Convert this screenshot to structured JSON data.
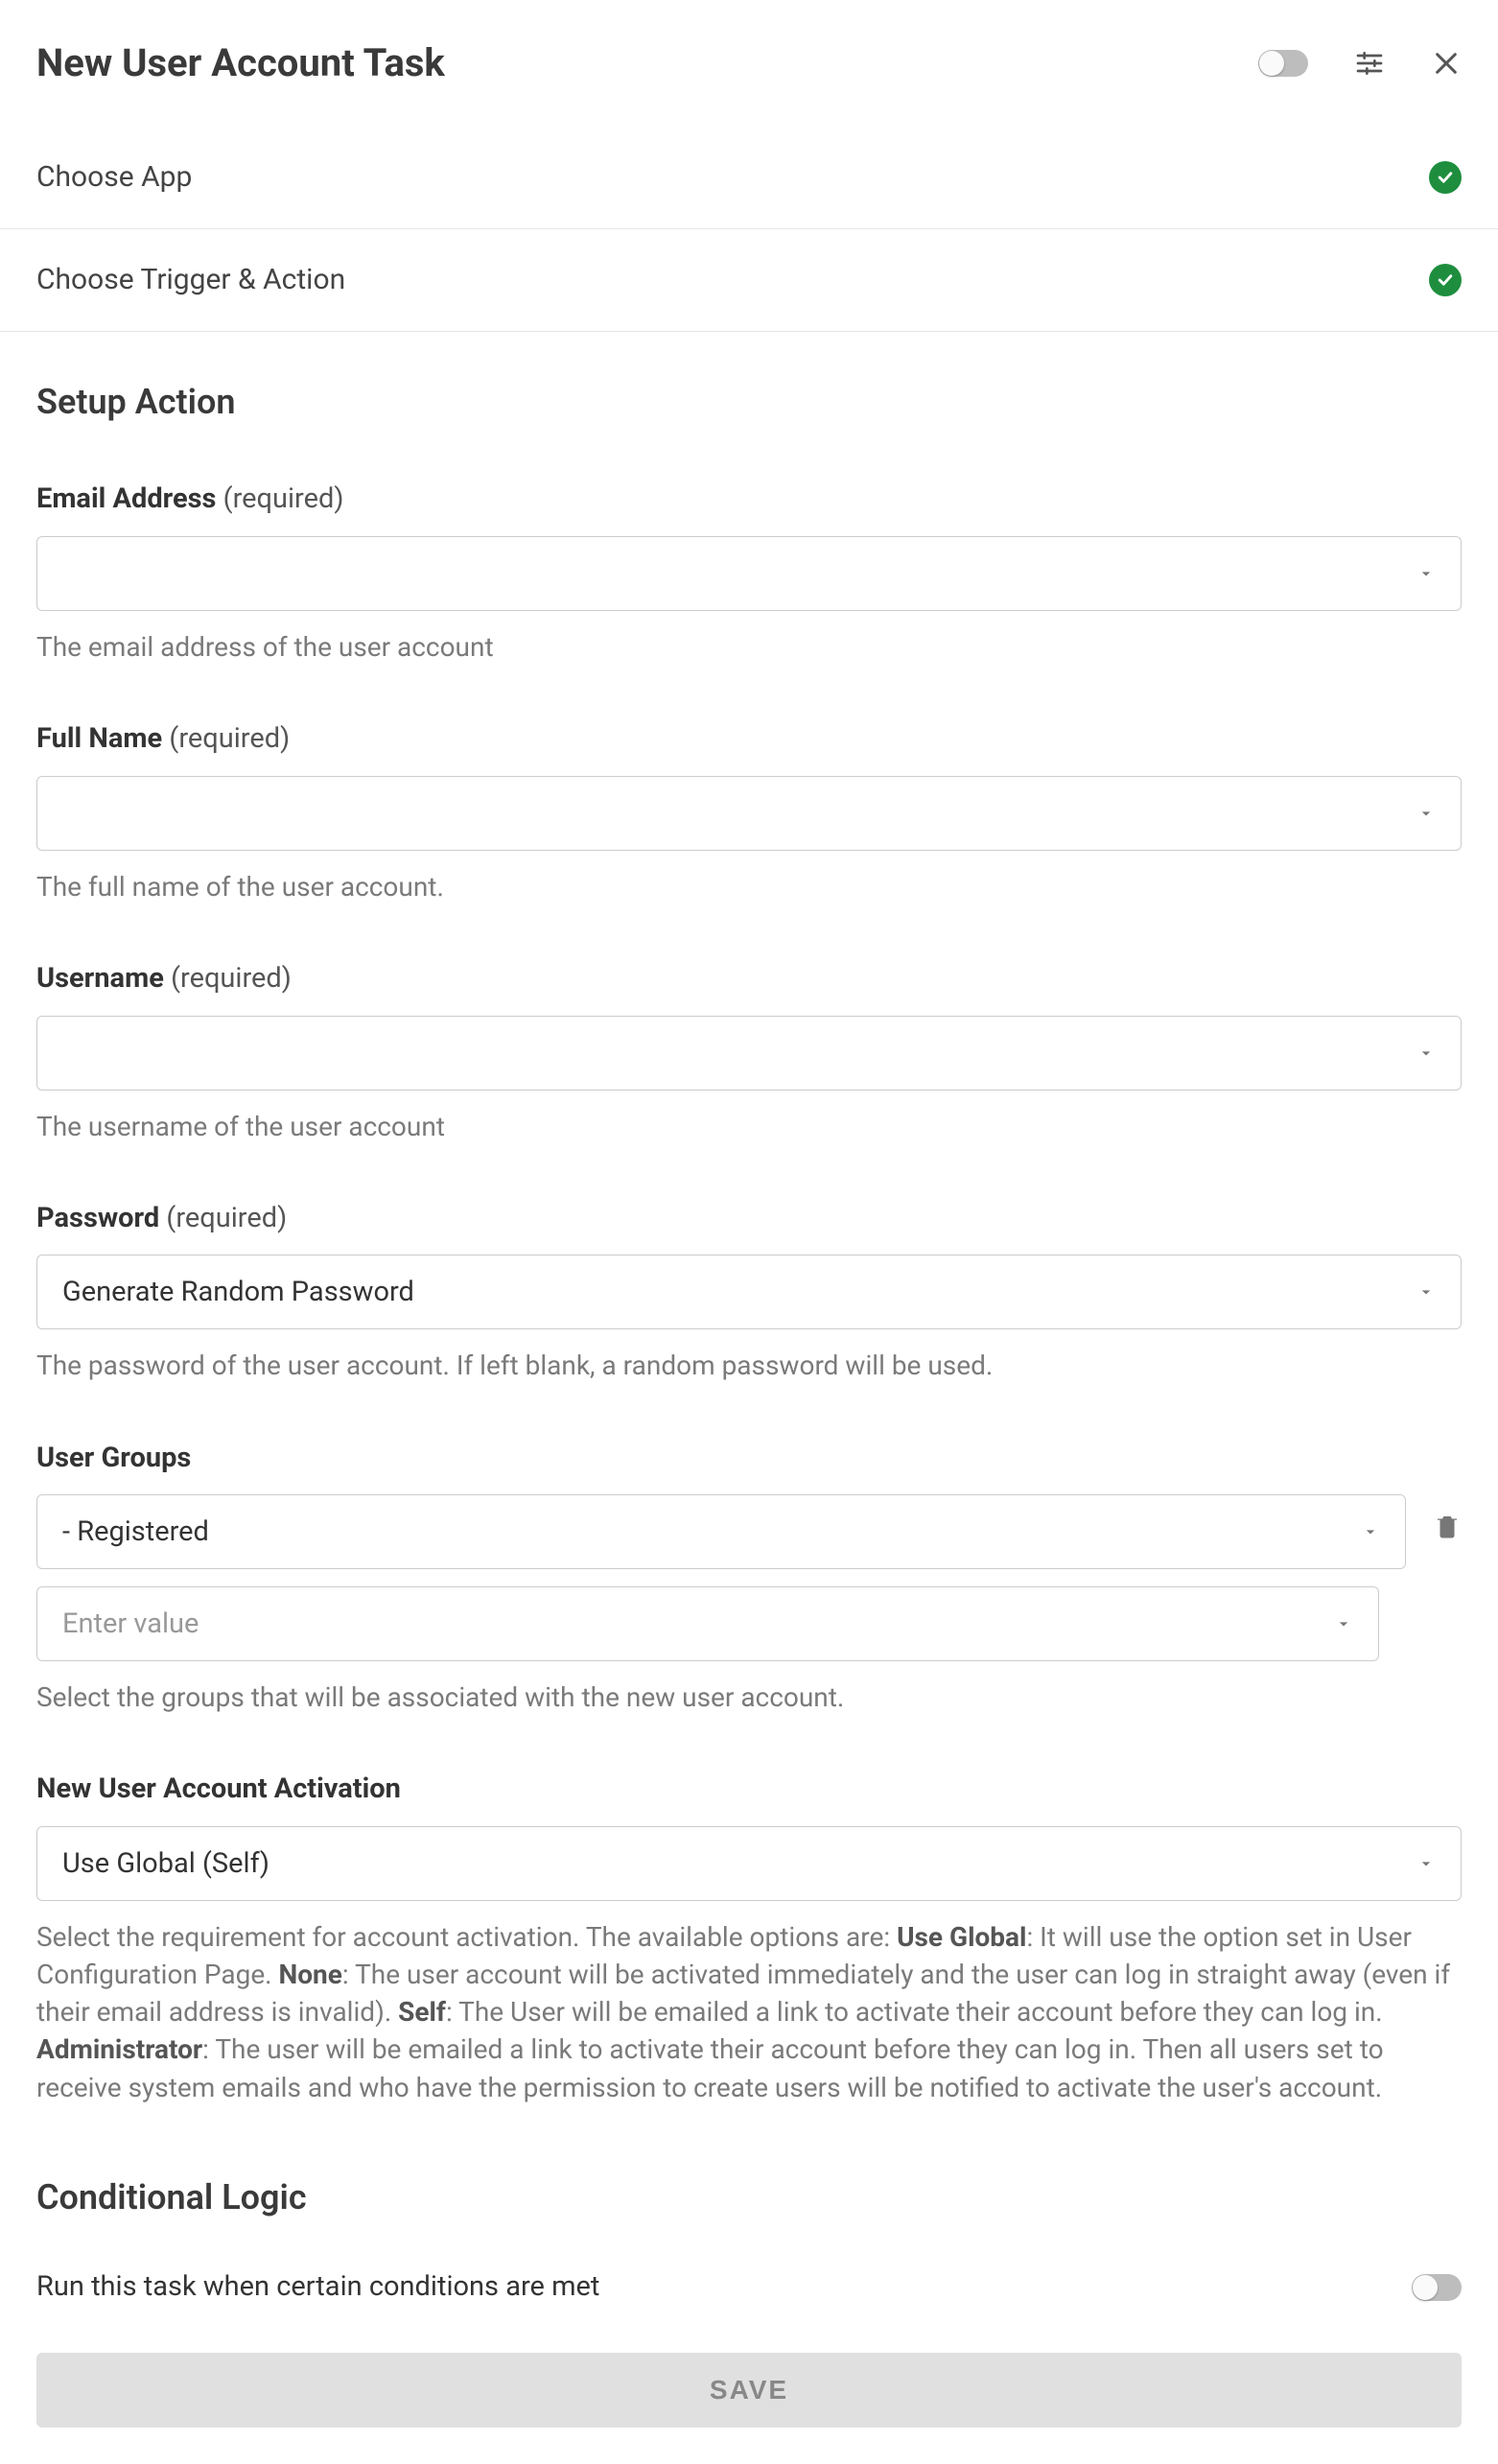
{
  "header": {
    "title": "New User Account Task"
  },
  "steps": {
    "choose_app": "Choose App",
    "choose_trigger": "Choose Trigger & Action"
  },
  "setup": {
    "title": "Setup Action",
    "required_suffix": "(required)",
    "email": {
      "label": "Email Address",
      "help": "The email address of the user account"
    },
    "fullname": {
      "label": "Full Name",
      "help": "The full name of the user account."
    },
    "username": {
      "label": "Username",
      "help": "The username of the user account"
    },
    "password": {
      "label": "Password",
      "value": "Generate Random Password",
      "help": "The password of the user account. If left blank, a random password will be used."
    },
    "groups": {
      "label": "User Groups",
      "value": "- Registered",
      "enter_placeholder": "Enter value",
      "help": "Select the groups that will be associated with the new user account."
    },
    "activation": {
      "label": "New User Account Activation",
      "value": "Use Global (Self)",
      "help_pre": "Select the requirement for account activation. The available options are: ",
      "use_global_b": "Use Global",
      "use_global_t": ": It will use the option set in User Configuration Page. ",
      "none_b": "None",
      "none_t": ": The user account will be activated immediately and the user can log in straight away (even if their email address is invalid). ",
      "self_b": "Self",
      "self_t": ": The User will be emailed a link to activate their account before they can log in. ",
      "admin_b": "Administrator",
      "admin_t": ": The user will be emailed a link to activate their account before they can log in. Then all users set to receive system emails and who have the permission to create users will be notified to activate the user's account."
    }
  },
  "conditional": {
    "title": "Conditional Logic",
    "text": "Run this task when certain conditions are met"
  },
  "save_label": "SAVE"
}
